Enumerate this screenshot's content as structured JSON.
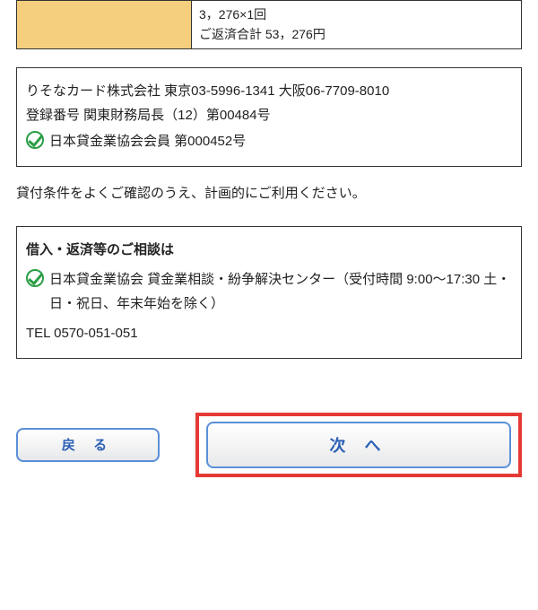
{
  "summary": {
    "line1": "3，276×1回",
    "line2": "ご返済合計 53，276円"
  },
  "company": {
    "name_phone": "りそなカード株式会社  東京03-5996-1341  大阪06-7709-8010",
    "registration": "登録番号  関東財務局長（12）第00484号",
    "member": "日本貸金業協会会員  第000452号"
  },
  "notice": "貸付条件をよくご確認のうえ、計画的にご利用ください。",
  "consult": {
    "title": "借入・返済等のご相談は",
    "body": "日本貸金業協会 貸金業相談・紛争解決センター（受付時間 9:00～17:30 土・日・祝日、年末年始を除く）",
    "tel": "TEL 0570-051-051"
  },
  "buttons": {
    "back": "戻 る",
    "next": "次  へ"
  }
}
